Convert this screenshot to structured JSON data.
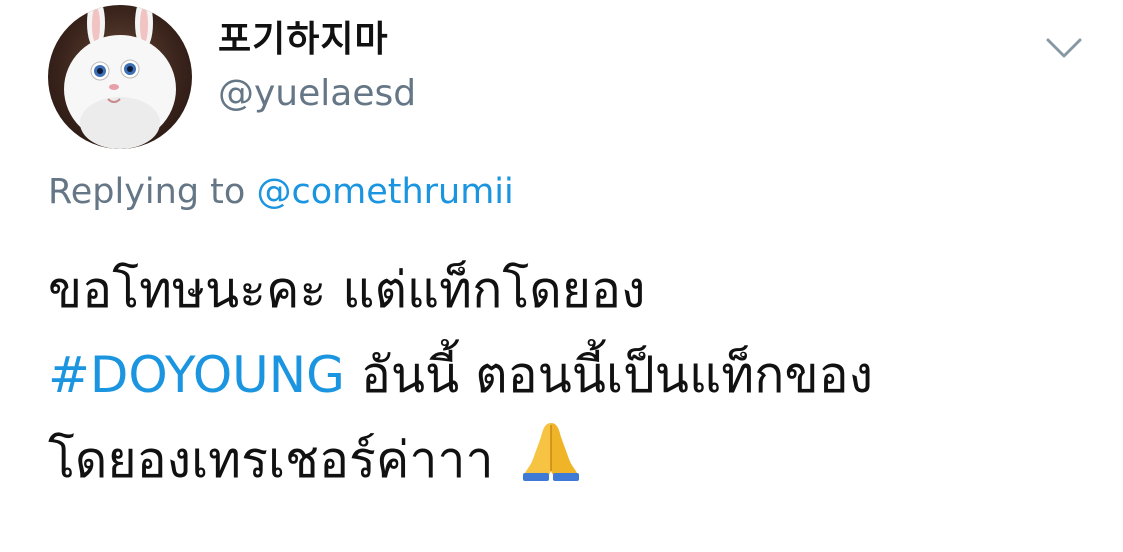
{
  "user": {
    "display_name": "포기하지마",
    "handle": "@yuelaesd",
    "avatar_icon": "white-bunny-avatar"
  },
  "menu": {
    "icon": "chevron-down-icon"
  },
  "reply": {
    "prefix": "Replying to ",
    "mention": "@comethrumii"
  },
  "tweet": {
    "line1": "ขอโทษนะคะ แต่แท็กโดยอง",
    "hashtag": "#DOYOUNG",
    "line2_rest": " อันนี้ ตอนนี้เป็นแท็กของ",
    "line3": "โดยองเทรเชอร์ค่าาา ",
    "emoji": "🙏"
  },
  "colors": {
    "link": "#1b95e0",
    "muted": "#657786",
    "text": "#111111"
  }
}
